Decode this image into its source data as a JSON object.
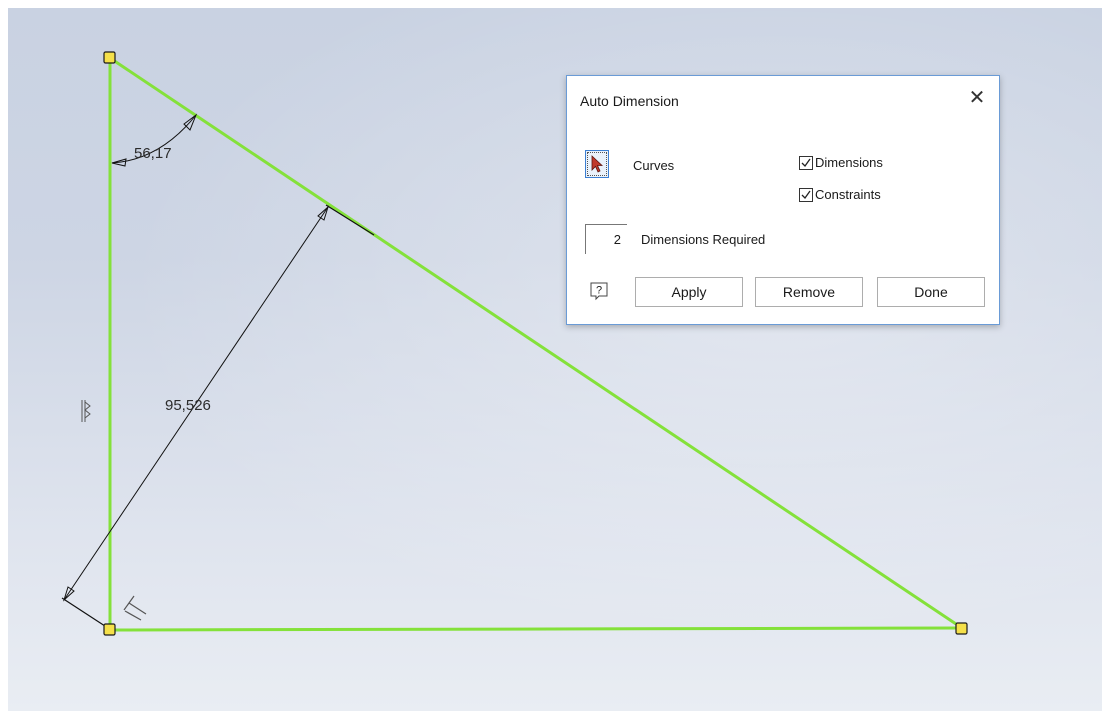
{
  "sketch": {
    "angle_dimension": "56,17",
    "length_dimension": "95,526",
    "line_color": "#84e13a",
    "point_color": "#f5e04a"
  },
  "dialog": {
    "title": "Auto Dimension",
    "close_icon": "close-icon",
    "curves_label": "Curves",
    "dimensions_label": "Dimensions",
    "dimensions_checked": true,
    "constraints_label": "Constraints",
    "constraints_checked": true,
    "required_count": "2",
    "required_label": "Dimensions Required",
    "apply_label": "Apply",
    "remove_label": "Remove",
    "done_label": "Done"
  }
}
